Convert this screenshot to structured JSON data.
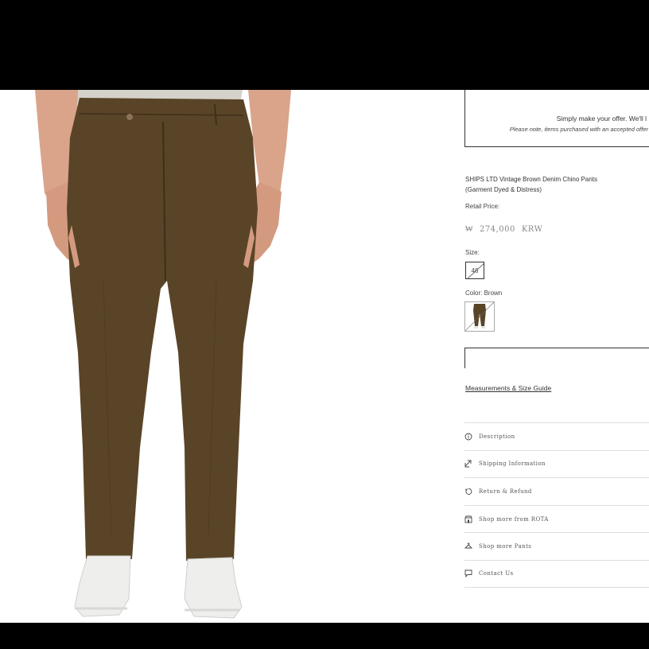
{
  "offer_box": {
    "line1": "Simply make your offer. We'll l",
    "line2": "Please note, items purchased with an accepted offer"
  },
  "product": {
    "title": "SHIPS LTD Vintage Brown Denim Chino Pants (Garment Dyed & Distress)",
    "retail_price_label": "Retail Price:",
    "currency_symbol": "₩",
    "price": "274,000",
    "currency_code": "KRW",
    "size_label": "Size:",
    "size_value": "46",
    "color_label": "Color: Brown",
    "measurements_link": "Measurements & Size Guide",
    "pants_color": "#5a4427"
  },
  "accordion": [
    {
      "label": "Description",
      "icon": "info-icon"
    },
    {
      "label": "Shipping Information",
      "icon": "shipping-icon"
    },
    {
      "label": "Return & Refund",
      "icon": "return-icon"
    },
    {
      "label": "Shop more from ROTA",
      "icon": "store-icon"
    },
    {
      "label": "Shop more Pants",
      "icon": "hanger-icon"
    },
    {
      "label": "Contact Us",
      "icon": "chat-icon"
    }
  ]
}
